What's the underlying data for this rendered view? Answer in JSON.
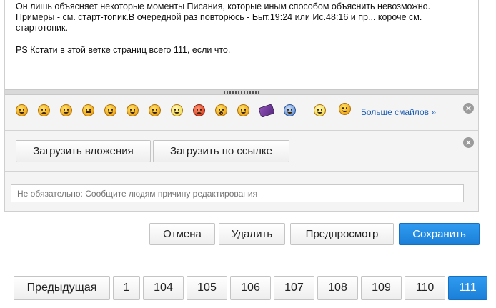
{
  "editor": {
    "lines": [
      "Он лишь объясняет некоторые моменты Писания, которые иным способом объяснить невозможно.",
      "Примеры - см. старт-топик.В очередной раз повторюсь - Быт.19:24 или Ис.48:16 и пр... короче см.",
      "стартотопик.",
      "PS Кстати в этой ветке страниц всего 111, если что."
    ]
  },
  "smileys": {
    "icons": [
      "smile-icon",
      "sad-icon",
      "surprised-icon",
      "neutral-icon",
      "grin-icon",
      "tongue-icon",
      "cool-icon",
      "eyes-icon",
      "angry-icon",
      "shocked-icon",
      "wink-icon",
      "book-icon",
      "blue-smile-icon",
      "thumbs-icon",
      "laugh-icon"
    ],
    "more_label": "Больше смайлов »"
  },
  "upload": {
    "attachments_label": "Загрузить вложения",
    "by_link_label": "Загрузить по ссылке"
  },
  "reason": {
    "placeholder": "Не обязательно: Сообщите людям причину редактирования"
  },
  "actions": {
    "cancel": "Отмена",
    "delete": "Удалить",
    "preview": "Предпросмотр",
    "save": "Сохранить"
  },
  "pagination": {
    "prev": "Предыдущая",
    "pages": [
      "1",
      "104",
      "105",
      "106",
      "107",
      "108",
      "109",
      "110",
      "111"
    ],
    "current": "111"
  },
  "colors": {
    "primary": "#1b7fd8",
    "link": "#1e5fb5"
  }
}
